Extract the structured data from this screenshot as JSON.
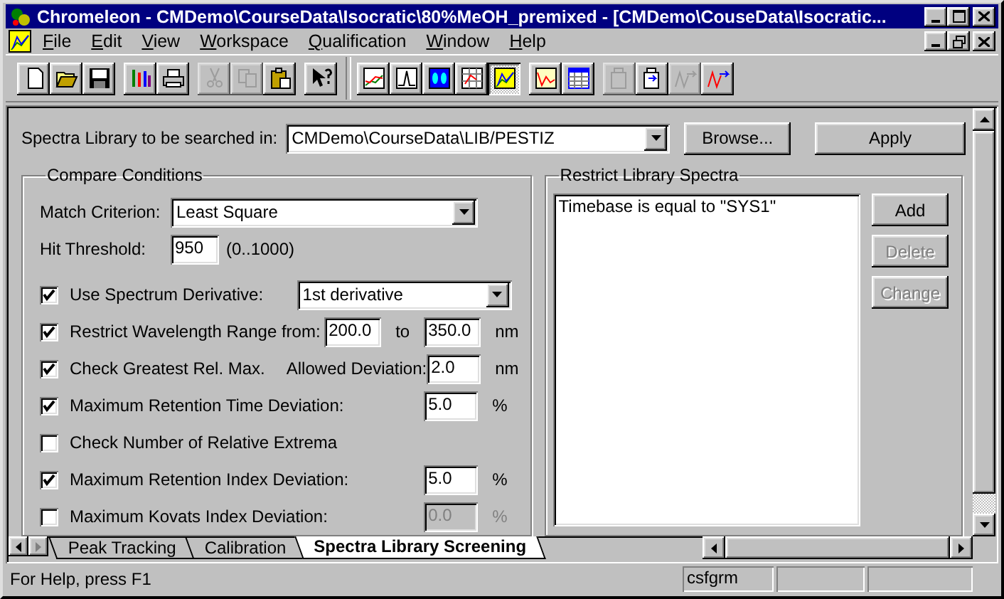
{
  "window": {
    "title": "Chromeleon - CMDemo\\CourseData\\Isocratic\\80%MeOH_premixed - [CMDemo\\CouseData\\Isocratic..."
  },
  "menu": [
    {
      "label": "File"
    },
    {
      "label": "Edit"
    },
    {
      "label": "View"
    },
    {
      "label": "Workspace"
    },
    {
      "label": "Qualification"
    },
    {
      "label": "Window"
    },
    {
      "label": "Help"
    }
  ],
  "toolbar": [
    [
      {
        "disabled": false,
        "pressed": false
      },
      {
        "disabled": false,
        "pressed": false
      },
      {
        "disabled": false,
        "pressed": false
      }
    ],
    [
      {
        "disabled": false,
        "pressed": false
      },
      {
        "disabled": false,
        "pressed": false
      }
    ],
    [
      {
        "disabled": true,
        "pressed": false
      },
      {
        "disabled": true,
        "pressed": false
      },
      {
        "disabled": false,
        "pressed": false
      }
    ],
    [
      {
        "disabled": false,
        "pressed": false
      }
    ],
    [
      {
        "disabled": false,
        "pressed": false
      },
      {
        "disabled": false,
        "pressed": false
      },
      {
        "disabled": false,
        "pressed": false
      },
      {
        "disabled": false,
        "pressed": false
      },
      {
        "disabled": false,
        "pressed": true
      }
    ],
    [
      {
        "disabled": false,
        "pressed": false
      },
      {
        "disabled": false,
        "pressed": false
      }
    ],
    [
      {
        "disabled": true,
        "pressed": false
      },
      {
        "disabled": false,
        "pressed": false
      },
      {
        "disabled": true,
        "pressed": false
      },
      {
        "disabled": false,
        "pressed": false
      }
    ]
  ],
  "library": {
    "label": "Spectra Library to be searched in:",
    "value": "CMDemo\\CourseData\\LIB/PESTIZ",
    "browse": "Browse...",
    "apply": "Apply"
  },
  "compare": {
    "title": "Compare Conditions",
    "match": {
      "label": "Match Criterion:",
      "value": "Least Square"
    },
    "threshold": {
      "label": "Hit Threshold:",
      "value": "950",
      "hint": "(0..1000)"
    },
    "options": [
      {
        "kind": "combo",
        "checked": true,
        "label": "Use Spectrum Derivative:",
        "value": "1st derivative"
      },
      {
        "kind": "range",
        "checked": true,
        "label": "Restrict Wavelength Range from:",
        "from": "200.0",
        "to_label": "to",
        "to": "350.0",
        "unit": "nm"
      },
      {
        "kind": "allowed",
        "checked": true,
        "label": "Check Greatest Rel. Max.",
        "sublabel": "Allowed Deviation:",
        "value": "2.0",
        "unit": "nm"
      },
      {
        "kind": "value",
        "checked": true,
        "label": "Maximum Retention Time Deviation:",
        "value": "5.0",
        "unit": "%",
        "disabled": false
      },
      {
        "kind": "plain",
        "checked": false,
        "label": "Check Number of Relative Extrema"
      },
      {
        "kind": "value",
        "checked": true,
        "label": "Maximum Retention Index Deviation:",
        "value": "5.0",
        "unit": "%",
        "disabled": false
      },
      {
        "kind": "value",
        "checked": false,
        "label": "Maximum Kovats Index Deviation:",
        "value": "0.0",
        "unit": "%",
        "disabled": true
      }
    ]
  },
  "restrict": {
    "title": "Restrict Library Spectra",
    "items": [
      "Timebase is equal to \"SYS1\""
    ],
    "buttons": [
      {
        "label": "Add",
        "disabled": false
      },
      {
        "label": "Delete",
        "disabled": true
      },
      {
        "label": "Change",
        "disabled": true
      }
    ]
  },
  "tabs": [
    {
      "label": "Peak Tracking",
      "selected": false
    },
    {
      "label": "Calibration",
      "selected": false
    },
    {
      "label": "Spectra Library Screening",
      "selected": true
    }
  ],
  "status": {
    "text": "For Help, press F1",
    "user": "csfgrm"
  }
}
